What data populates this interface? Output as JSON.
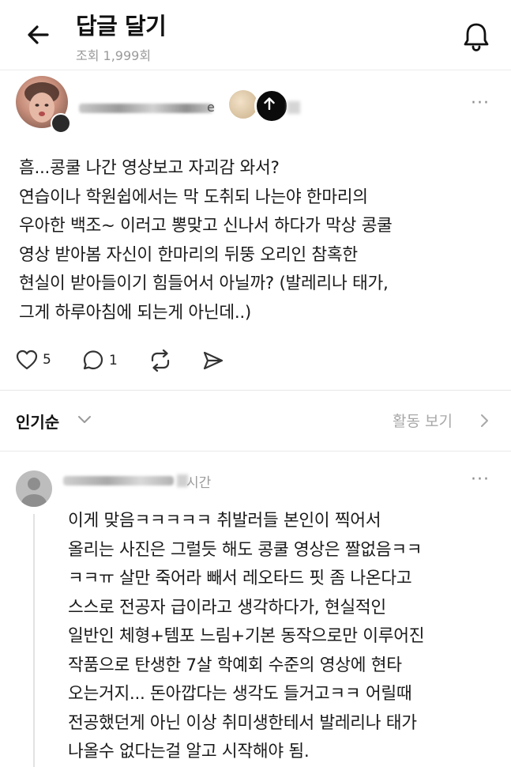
{
  "header": {
    "title": "답글 달기",
    "views": "조회 1,999회"
  },
  "post": {
    "username_suffix": "e",
    "text": "흠...콩쿨 나간 영상보고 자괴감 와서?\n연습이나 학원쉽에서는 막 도취되 나는야 한마리의\n우아한 백조~ 이러고 뽕맞고 신나서 하다가 막상 콩쿨\n영상 받아봄 자신이 한마리의 뒤뚱 오리인 참혹한\n현실이 받아들이기 힘들어서 아닐까? (발레리나 태가,\n그게 하루아침에 되는게 아닌데..)",
    "likes": "5",
    "replies": "1"
  },
  "sort": {
    "label": "인기순",
    "activity_label": "활동 보기"
  },
  "reply": {
    "time_suffix": "시간",
    "text": "이게 맞음ㅋㅋㅋㅋㅋ 취발러들 본인이 찍어서\n올리는 사진은 그럴듯 해도 콩쿨 영상은 짤없음ㅋㅋ\nㅋㅋㅠ 살만 죽어라 빼서 레오타드 핏 좀 나온다고\n스스로 전공자 급이라고 생각하다가, 현실적인\n일반인 체형+템포 느림+기본 동작으로만 이루어진\n작품으로 탄생한 7살 학예회 수준의 영상에 현타\n오는거지... 돈아깝다는 생각도 들거고ㅋㅋ 어릴때\n전공했던게 아닌 이상 취미생한테서 발레리나 태가\n나올수 없다는걸 알고 시작해야 됨."
  },
  "icons": {
    "back": "arrow-left-icon",
    "bell": "bell-icon",
    "follow": "arrow-up-icon",
    "more": "more-horizontal-icon",
    "like": "heart-icon",
    "comment": "comment-icon",
    "repost": "repost-icon",
    "share": "send-icon"
  },
  "colors": {
    "text": "#1a1a1a",
    "muted": "#9a9a9a",
    "follow_button": "#0b0b0b"
  }
}
